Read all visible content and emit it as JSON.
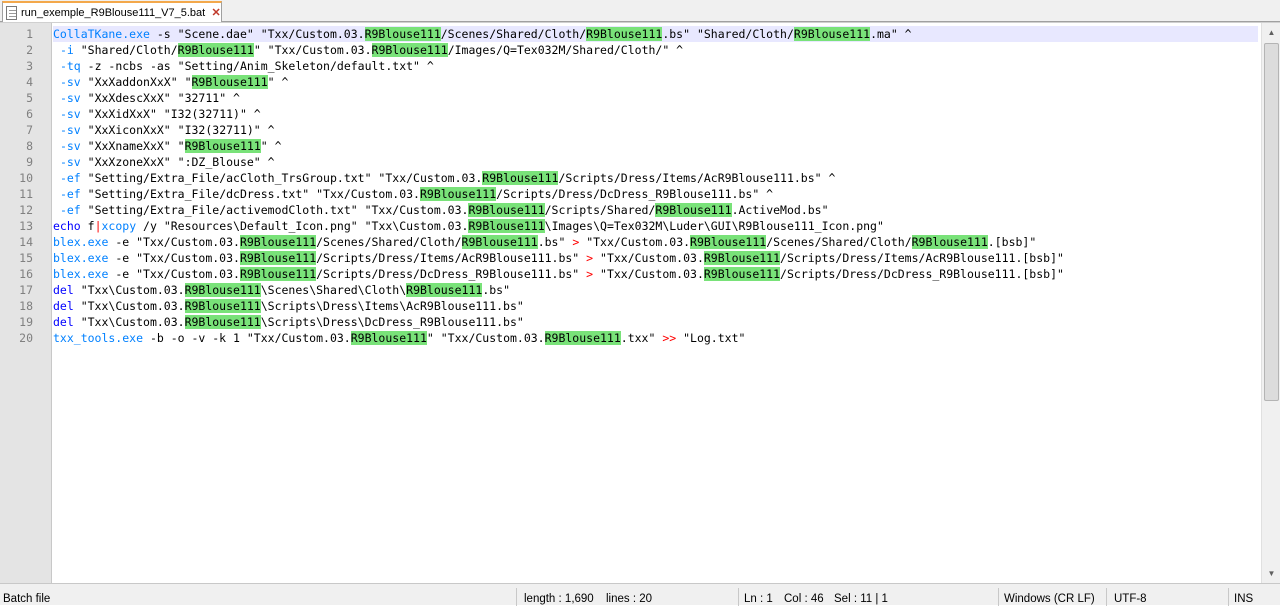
{
  "tab": {
    "title": "run_exemple_R9Blouse111_V7_5.bat",
    "close_icon": "close-icon",
    "file_icon": "text-file-icon"
  },
  "editor": {
    "line_numbers": [
      "1",
      "2",
      "3",
      "4",
      "5",
      "6",
      "7",
      "8",
      "9",
      "10",
      "11",
      "12",
      "13",
      "14",
      "15",
      "16",
      "17",
      "18",
      "19",
      "20"
    ],
    "current_line": 1,
    "lines": [
      [
        {
          "t": "CollaTKane.exe",
          "c": "var"
        },
        {
          "t": " -s \"Scene.dae\" \"Txx/Custom.03."
        },
        {
          "t": "R9Blouse111",
          "c": "hl"
        },
        {
          "t": "/Scenes/Shared/Cloth/"
        },
        {
          "t": "R9Blouse111",
          "c": "hl"
        },
        {
          "t": ".bs\" \"Shared/Cloth/"
        },
        {
          "t": "R9Blouse111",
          "c": "hl"
        },
        {
          "t": ".ma\" ^"
        }
      ],
      [
        {
          "t": " "
        },
        {
          "t": "-i",
          "c": "var"
        },
        {
          "t": " \"Shared/Cloth/"
        },
        {
          "t": "R9Blouse111",
          "c": "hl"
        },
        {
          "t": "\" \"Txx/Custom.03."
        },
        {
          "t": "R9Blouse111",
          "c": "hl"
        },
        {
          "t": "/Images/Q=Tex032M/Shared/Cloth/\" ^"
        }
      ],
      [
        {
          "t": " "
        },
        {
          "t": "-tq",
          "c": "var"
        },
        {
          "t": " -z -ncbs -as \"Setting/Anim_Skeleton/default.txt\" ^"
        }
      ],
      [
        {
          "t": " "
        },
        {
          "t": "-sv",
          "c": "var"
        },
        {
          "t": " \"XxXaddonXxX\" \""
        },
        {
          "t": "R9Blouse111",
          "c": "hl"
        },
        {
          "t": "\" ^"
        }
      ],
      [
        {
          "t": " "
        },
        {
          "t": "-sv",
          "c": "var"
        },
        {
          "t": " \"XxXdescXxX\" \"32711\" ^"
        }
      ],
      [
        {
          "t": " "
        },
        {
          "t": "-sv",
          "c": "var"
        },
        {
          "t": " \"XxXidXxX\" \"I32(32711)\" ^"
        }
      ],
      [
        {
          "t": " "
        },
        {
          "t": "-sv",
          "c": "var"
        },
        {
          "t": " \"XxXiconXxX\" \"I32(32711)\" ^"
        }
      ],
      [
        {
          "t": " "
        },
        {
          "t": "-sv",
          "c": "var"
        },
        {
          "t": " \"XxXnameXxX\" \""
        },
        {
          "t": "R9Blouse111",
          "c": "hl"
        },
        {
          "t": "\" ^"
        }
      ],
      [
        {
          "t": " "
        },
        {
          "t": "-sv",
          "c": "var"
        },
        {
          "t": " \"XxXzoneXxX\" \":DZ_Blouse\" ^"
        }
      ],
      [
        {
          "t": " "
        },
        {
          "t": "-ef",
          "c": "var"
        },
        {
          "t": " \"Setting/Extra_File/acCloth_TrsGroup.txt\" \"Txx/Custom.03."
        },
        {
          "t": "R9Blouse111",
          "c": "hl"
        },
        {
          "t": "/Scripts/Dress/Items/AcR9Blouse111.bs\" ^"
        }
      ],
      [
        {
          "t": " "
        },
        {
          "t": "-ef",
          "c": "var"
        },
        {
          "t": " \"Setting/Extra_File/dcDress.txt\" \"Txx/Custom.03."
        },
        {
          "t": "R9Blouse111",
          "c": "hl"
        },
        {
          "t": "/Scripts/Dress/DcDress_R9Blouse111.bs\" ^"
        }
      ],
      [
        {
          "t": " "
        },
        {
          "t": "-ef",
          "c": "var"
        },
        {
          "t": " \"Setting/Extra_File/activemodCloth.txt\" \"Txx/Custom.03."
        },
        {
          "t": "R9Blouse111",
          "c": "hl"
        },
        {
          "t": "/Scripts/Shared/"
        },
        {
          "t": "R9Blouse111",
          "c": "hl"
        },
        {
          "t": ".ActiveMod.bs\""
        }
      ],
      [
        {
          "t": "echo",
          "c": "cmd"
        },
        {
          "t": " f"
        },
        {
          "t": "|",
          "c": "op"
        },
        {
          "t": "xcopy",
          "c": "var"
        },
        {
          "t": " /y \"Resources\\Default_Icon.png\" \"Txx\\Custom.03."
        },
        {
          "t": "R9Blouse111",
          "c": "hl"
        },
        {
          "t": "\\Images\\Q=Tex032M\\Luder\\GUI\\R9Blouse111_Icon.png\""
        }
      ],
      [
        {
          "t": "blex.exe",
          "c": "var"
        },
        {
          "t": " -e \"Txx/Custom.03."
        },
        {
          "t": "R9Blouse111",
          "c": "hl"
        },
        {
          "t": "/Scenes/Shared/Cloth/"
        },
        {
          "t": "R9Blouse111",
          "c": "hl"
        },
        {
          "t": ".bs\" "
        },
        {
          "t": ">",
          "c": "op"
        },
        {
          "t": " \"Txx/Custom.03."
        },
        {
          "t": "R9Blouse111",
          "c": "hl"
        },
        {
          "t": "/Scenes/Shared/Cloth/"
        },
        {
          "t": "R9Blouse111",
          "c": "hl"
        },
        {
          "t": ".[bsb]\""
        }
      ],
      [
        {
          "t": "blex.exe",
          "c": "var"
        },
        {
          "t": " -e \"Txx/Custom.03."
        },
        {
          "t": "R9Blouse111",
          "c": "hl"
        },
        {
          "t": "/Scripts/Dress/Items/AcR9Blouse111.bs\" "
        },
        {
          "t": ">",
          "c": "op"
        },
        {
          "t": " \"Txx/Custom.03."
        },
        {
          "t": "R9Blouse111",
          "c": "hl"
        },
        {
          "t": "/Scripts/Dress/Items/AcR9Blouse111.[bsb]\""
        }
      ],
      [
        {
          "t": "blex.exe",
          "c": "var"
        },
        {
          "t": " -e \"Txx/Custom.03."
        },
        {
          "t": "R9Blouse111",
          "c": "hl"
        },
        {
          "t": "/Scripts/Dress/DcDress_R9Blouse111.bs\" "
        },
        {
          "t": ">",
          "c": "op"
        },
        {
          "t": " \"Txx/Custom.03."
        },
        {
          "t": "R9Blouse111",
          "c": "hl"
        },
        {
          "t": "/Scripts/Dress/DcDress_R9Blouse111.[bsb]\""
        }
      ],
      [
        {
          "t": "del",
          "c": "cmd"
        },
        {
          "t": " \"Txx\\Custom.03."
        },
        {
          "t": "R9Blouse111",
          "c": "hl"
        },
        {
          "t": "\\Scenes\\Shared\\Cloth\\"
        },
        {
          "t": "R9Blouse111",
          "c": "hl"
        },
        {
          "t": ".bs\""
        }
      ],
      [
        {
          "t": "del",
          "c": "cmd"
        },
        {
          "t": " \"Txx\\Custom.03."
        },
        {
          "t": "R9Blouse111",
          "c": "hl"
        },
        {
          "t": "\\Scripts\\Dress\\Items\\AcR9Blouse111.bs\""
        }
      ],
      [
        {
          "t": "del",
          "c": "cmd"
        },
        {
          "t": " \"Txx\\Custom.03."
        },
        {
          "t": "R9Blouse111",
          "c": "hl"
        },
        {
          "t": "\\Scripts\\Dress\\DcDress_R9Blouse111.bs\""
        }
      ],
      [
        {
          "t": "txx_tools.exe",
          "c": "var"
        },
        {
          "t": " -b -o -v -k 1 \"Txx/Custom.03."
        },
        {
          "t": "R9Blouse111",
          "c": "hl"
        },
        {
          "t": "\" \"Txx/Custom.03."
        },
        {
          "t": "R9Blouse111",
          "c": "hl"
        },
        {
          "t": ".txx\" "
        },
        {
          "t": ">>",
          "c": "op"
        },
        {
          "t": " \"Log.txt\""
        }
      ]
    ]
  },
  "status": {
    "file_type": "Batch file",
    "length": "length : 1,690",
    "lines": "lines : 20",
    "ln": "Ln : 1",
    "col": "Col : 46",
    "sel": "Sel : 11 | 1",
    "eol": "Windows (CR LF)",
    "encoding": "UTF-8",
    "mode": "INS"
  },
  "colors": {
    "highlight": "#79e279",
    "keyword": "#0000ff",
    "variable": "#0080ff",
    "operator": "#ff0000",
    "tab_accent": "#f3a84b"
  }
}
